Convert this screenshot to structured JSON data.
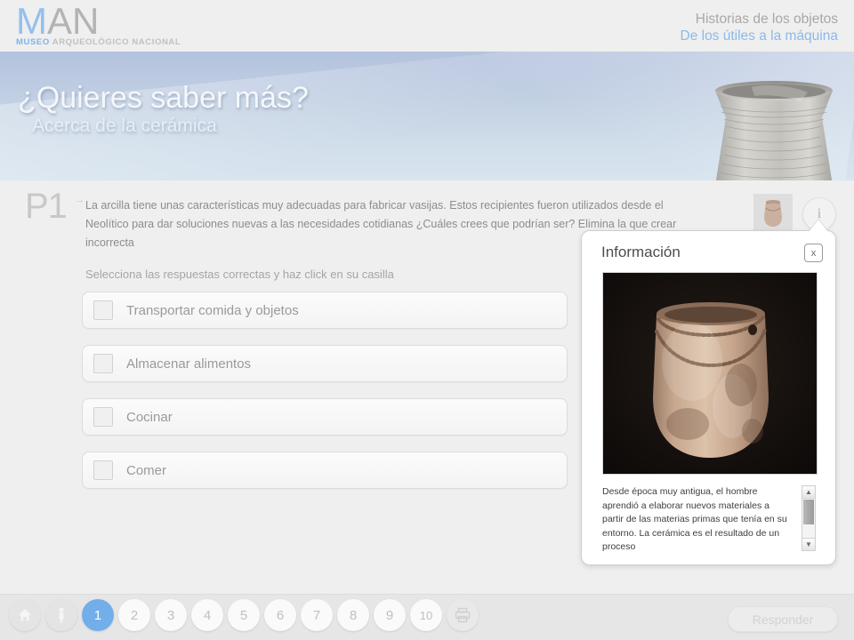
{
  "header": {
    "logo_main_highlight": "M",
    "logo_main_rest": "AN",
    "logo_sub_highlight": "MUSEO",
    "logo_sub_rest": " ARQUEOLÓGICO NACIONAL",
    "title_line1": "Historias de los objetos",
    "title_line2": "De los útiles a la máquina",
    "colors": {
      "blue": "#8cb9e8",
      "gray": "#a8a8a8"
    }
  },
  "banner": {
    "title": "¿Quieres saber más?",
    "subtitle": "Acerca de la cerámica",
    "vessel_alt": "ceramic-vessel"
  },
  "question": {
    "number": "P1",
    "arrow": "→",
    "text": "La arcilla tiene unas características muy adecuadas para fabricar vasijas. Estos recipientes fueron utilizados desde el Neolítico para dar soluciones nuevas a las necesidades cotidianas ¿Cuáles crees que podrían ser? Elimina la que crear incorrecta",
    "instruction": "Selecciona las respuestas correctas y haz click en su casilla",
    "options": [
      {
        "label": "Transportar comida y objetos",
        "checked": false
      },
      {
        "label": "Almacenar alimentos",
        "checked": false
      },
      {
        "label": "Cocinar",
        "checked": false
      },
      {
        "label": "Comer",
        "checked": false
      }
    ]
  },
  "info_button": {
    "glyph": "i",
    "icon_name": "info-icon"
  },
  "info_panel": {
    "title": "Información",
    "close_label": "x",
    "image_alt": "neolithic-ceramic-vessel",
    "body_text": "Desde época muy antigua, el hombre aprendió a elaborar nuevos materiales a partir de las materias primas que tenía en su entorno. La cerámica es el resultado de un proceso",
    "scroll_up": "▲",
    "scroll_down": "▼"
  },
  "bottom_bar": {
    "home_icon": "home-icon",
    "person_icon": "person-icon",
    "print_icon": "printer-icon",
    "pages": [
      "1",
      "2",
      "3",
      "4",
      "5",
      "6",
      "7",
      "8",
      "9",
      "10"
    ],
    "active_page": "1",
    "submit_label": "Responder",
    "active_color": "#72aeea"
  }
}
